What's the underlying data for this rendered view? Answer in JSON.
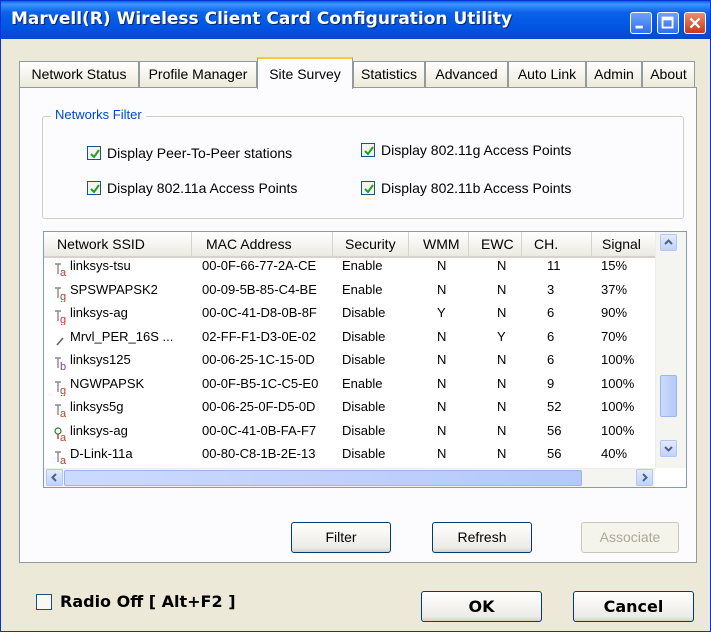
{
  "window": {
    "title": "Marvell(R) Wireless Client Card Configuration Utility"
  },
  "tabs": [
    {
      "label": "Network Status"
    },
    {
      "label": "Profile Manager"
    },
    {
      "label": "Site Survey"
    },
    {
      "label": "Statistics"
    },
    {
      "label": "Advanced"
    },
    {
      "label": "Auto Link"
    },
    {
      "label": "Admin"
    },
    {
      "label": "About"
    }
  ],
  "active_tab": "Site Survey",
  "filter": {
    "legend": "Networks Filter",
    "peer_to_peer": {
      "label": "Display Peer-To-Peer stations",
      "checked": true
    },
    "a_points": {
      "label": "Display 802.11a Access Points",
      "checked": true
    },
    "g_points": {
      "label": "Display 802.11g Access Points",
      "checked": true
    },
    "b_points": {
      "label": "Display 802.11b Access Points",
      "checked": true
    }
  },
  "table": {
    "columns": [
      "Network SSID",
      "MAC Address",
      "Security",
      "WMM",
      "EWC",
      "CH.",
      "Signal"
    ],
    "rows": [
      {
        "mode": "a",
        "ssid": "linksys-tsu",
        "mac": "00-0F-66-77-2A-CE",
        "security": "Enable",
        "wmm": "N",
        "ewc": "N",
        "ch": "11",
        "signal": "15%"
      },
      {
        "mode": "g",
        "ssid": "SPSWPAPSK2",
        "mac": "00-09-5B-85-C4-BE",
        "security": "Enable",
        "wmm": "N",
        "ewc": "N",
        "ch": "3",
        "signal": "37%"
      },
      {
        "mode": "g",
        "ssid": "linksys-ag",
        "mac": "00-0C-41-D8-0B-8F",
        "security": "Disable",
        "wmm": "Y",
        "ewc": "N",
        "ch": "6",
        "signal": "90%"
      },
      {
        "mode": "adhoc",
        "ssid": "Mrvl_PER_16S ...",
        "mac": "02-FF-F1-D3-0E-02",
        "security": "Disable",
        "wmm": "N",
        "ewc": "Y",
        "ch": "6",
        "signal": "70%"
      },
      {
        "mode": "b",
        "ssid": "linksys125",
        "mac": "00-06-25-1C-15-0D",
        "security": "Disable",
        "wmm": "N",
        "ewc": "N",
        "ch": "6",
        "signal": "100%"
      },
      {
        "mode": "g",
        "ssid": "NGWPAPSK",
        "mac": "00-0F-B5-1C-C5-E0",
        "security": "Enable",
        "wmm": "N",
        "ewc": "N",
        "ch": "9",
        "signal": "100%"
      },
      {
        "mode": "a",
        "ssid": "linksys5g",
        "mac": "00-06-25-0F-D5-0D",
        "security": "Disable",
        "wmm": "N",
        "ewc": "N",
        "ch": "52",
        "signal": "100%"
      },
      {
        "mode": "a-connected",
        "ssid": "linksys-ag",
        "mac": "00-0C-41-0B-FA-F7",
        "security": "Disable",
        "wmm": "N",
        "ewc": "N",
        "ch": "56",
        "signal": "100%"
      },
      {
        "mode": "a",
        "ssid": "D-Link-11a",
        "mac": "00-80-C8-1B-2E-13",
        "security": "Disable",
        "wmm": "N",
        "ewc": "N",
        "ch": "56",
        "signal": "40%"
      }
    ]
  },
  "buttons": {
    "filter": "Filter",
    "refresh": "Refresh",
    "associate": "Associate",
    "ok": "OK",
    "cancel": "Cancel"
  },
  "radio_off": {
    "label": "Radio Off  [ Alt+F2 ]",
    "checked": false
  },
  "colors": {
    "mode_a": "#c0392b",
    "mode_b": "#7a3fb0",
    "mode_g": "#c0392b",
    "selected_tab_accent": "#ffc73c"
  },
  "icons": {
    "mode_a": "antenna-a-icon",
    "mode_b": "antenna-b-icon",
    "mode_g": "antenna-g-icon",
    "adhoc": "peer-to-peer-icon",
    "connected": "connected-antenna-icon"
  }
}
